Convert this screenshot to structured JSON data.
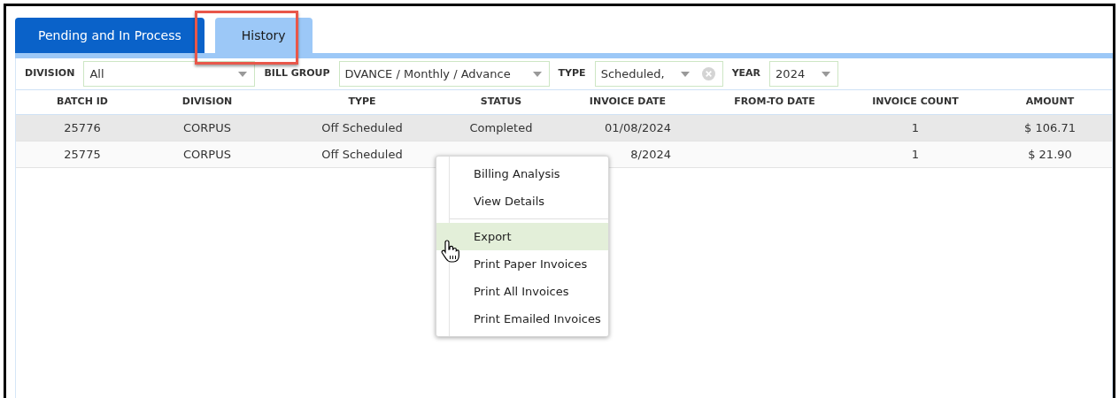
{
  "tabs": [
    {
      "label": "Pending and In Process",
      "selected": false
    },
    {
      "label": "History",
      "selected": true
    }
  ],
  "filters": [
    {
      "label": "DIVISION",
      "value": "All",
      "clearable": false
    },
    {
      "label": "BILL GROUP",
      "value": "DVANCE / Monthly / Advance",
      "clearable": false
    },
    {
      "label": "TYPE",
      "value": "Scheduled,",
      "clearable": true
    },
    {
      "label": "YEAR",
      "value": "2024",
      "clearable": false
    }
  ],
  "table": {
    "columns": [
      "BATCH ID",
      "DIVISION",
      "TYPE",
      "STATUS",
      "INVOICE DATE",
      "FROM-TO DATE",
      "INVOICE COUNT",
      "AMOUNT"
    ],
    "rows": [
      {
        "selected": true,
        "cells": [
          "25776",
          "CORPUS",
          "Off Scheduled",
          "Completed",
          "01/08/2024",
          "",
          "1",
          "$ 106.71"
        ]
      },
      {
        "selected": false,
        "cells": [
          "25775",
          "CORPUS",
          "Off Scheduled",
          "",
          "8/2024",
          "",
          "1",
          "$ 21.90"
        ]
      }
    ]
  },
  "context_menu": {
    "items": [
      {
        "label": "Billing Analysis",
        "highlighted": false,
        "separator_after": false
      },
      {
        "label": "View Details",
        "highlighted": false,
        "separator_after": true
      },
      {
        "label": "Export",
        "highlighted": true,
        "separator_after": false
      },
      {
        "label": "Print Paper Invoices",
        "highlighted": false,
        "separator_after": false
      },
      {
        "label": "Print All Invoices",
        "highlighted": false,
        "separator_after": false
      },
      {
        "label": "Print Emailed Invoices",
        "highlighted": false,
        "separator_after": false
      }
    ]
  }
}
